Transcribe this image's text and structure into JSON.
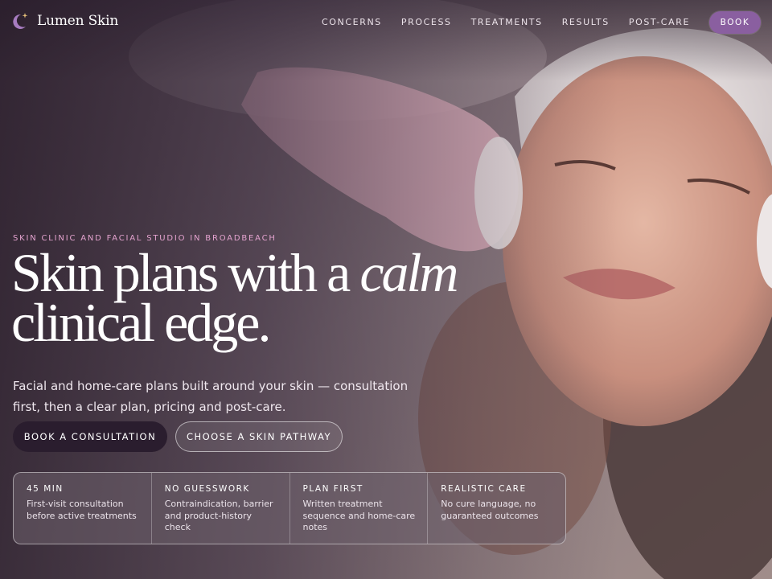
{
  "brand": {
    "name": "Lumen Skin",
    "icon": "crescent-moon-sparkle-icon"
  },
  "nav": {
    "links": [
      "CONCERNS",
      "PROCESS",
      "TREATMENTS",
      "RESULTS",
      "POST-CARE"
    ],
    "book_label": "BOOK"
  },
  "hero": {
    "eyebrow": "SKIN CLINIC AND FACIAL STUDIO IN BROADBEACH",
    "headline_line1": "Skin plans with a ",
    "headline_italic": "calm",
    "headline_line2": "clinical edge.",
    "subtitle": "Facial and home-care plans built around your skin — consultation first, then a clear plan, pricing and post-care.",
    "primary_cta": "BOOK A CONSULTATION",
    "secondary_cta": "CHOOSE A SKIN PATHWAY"
  },
  "facts": [
    {
      "title": "45 MIN",
      "text": "First-visit consultation before active treatments"
    },
    {
      "title": "NO GUESSWORK",
      "text": "Contraindication, barrier and product-history check"
    },
    {
      "title": "PLAN FIRST",
      "text": "Written treatment sequence and home-care notes"
    },
    {
      "title": "REALISTIC CARE",
      "text": "No cure language, no guaranteed outcomes"
    }
  ],
  "colors": {
    "accent_pink": "#e4a3cf",
    "book_purple": "#8a5fa0",
    "primary_button": "#2a1d2e"
  }
}
